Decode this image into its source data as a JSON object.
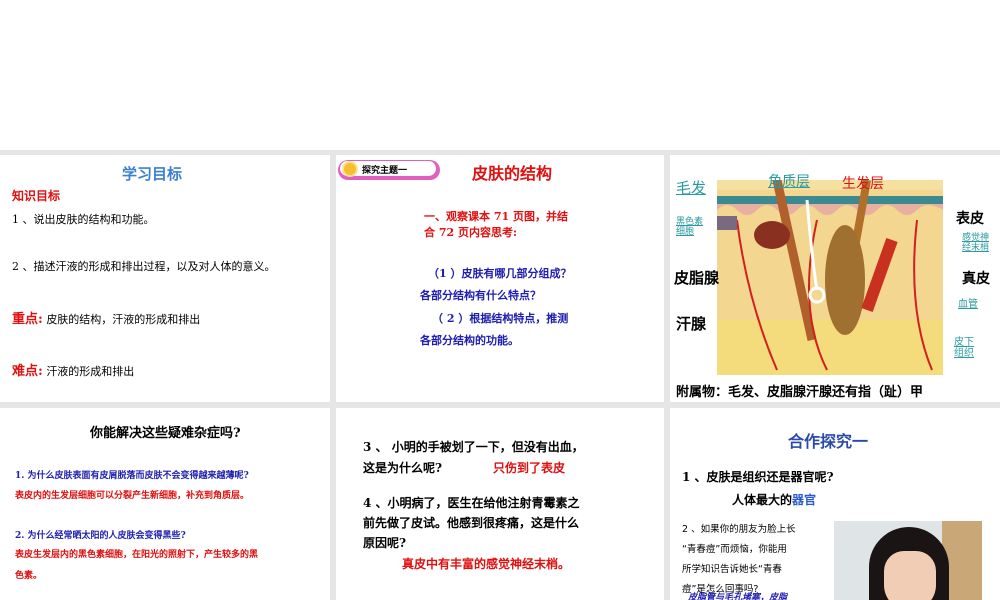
{
  "slide1": {
    "title": "学习目标",
    "subtitle": "知识目标",
    "item1": "1 、说出皮肤的结构和功能。",
    "item2": "2 、描述汗液的形成和排出过程，以及对人体的意义。",
    "key_label": "重点:",
    "key_text": "皮肤的结构，汗液的形成和排出",
    "diff_label": "难点:",
    "diff_text": "汗液的形成和排出"
  },
  "slide2": {
    "badge": "探究主题一",
    "title": "皮肤的结构",
    "intro1": "一、观察课本 71 页图，并结",
    "intro2": "合 72 页内容思考:",
    "q1a": "（1 ）皮肤有哪几部分组成？",
    "q1b": "各部分结构有什么特点？",
    "q2a": "（ 2 ）根据结构特点，推测",
    "q2b": "各部分结构的功能。"
  },
  "slide3": {
    "labels": {
      "hair": "毛发",
      "stratum": "角质层",
      "germ": "生发层",
      "melano": [
        "黑色素",
        "细胞"
      ],
      "sebaceous": "皮脂腺",
      "sweat": "汗腺",
      "epidermis": "表皮",
      "nerve": [
        "感觉神",
        "经末梢"
      ],
      "dermis": "真皮",
      "vessel": "血管",
      "subcut": [
        "皮下",
        "组织"
      ]
    },
    "caption": "附属物：毛发、皮脂腺汗腺还有指（趾）甲"
  },
  "slide4": {
    "title": "你能解决这些疑难杂症吗?",
    "q1": "1. 为什么皮肤表面有皮屑脱落而皮肤不会变得越来越薄呢?",
    "a1": "表皮内的生发层细胞可以分裂产生新细胞，补充到角质层。",
    "q2": "2. 为什么经常晒太阳的人皮肤会变得黑些?",
    "a2a": "表皮生发层内的黑色素细胞，在阳光的照射下，产生较多的黑",
    "a2b": "色素。"
  },
  "slide5": {
    "q3a": "3 、   小明的手被划了一下，但没有出血，",
    "q3b": "这是为什么呢?",
    "a3": "只伤到了表皮",
    "q4a": "4 、小明病了，医生在给他注射青霉素之",
    "q4b": "前先做了皮试。他感到很疼痛，这是什么",
    "q4c": "原因呢?",
    "a4": "真皮中有丰富的感觉神经末梢。"
  },
  "slide6": {
    "title": "合作探究一",
    "q1": "1 、皮肤是组织还是器官呢?",
    "a1_prefix": "人体最大的",
    "a1_highlight": "器官",
    "q2": [
      "2 、如果你的朋友为脸上长",
      "“青春痘”而烦恼，你能用",
      "所学知识告诉她长“青春",
      "痘”是怎么回事吗?"
    ],
    "a2": "皮脂管与毛孔堵塞，皮脂"
  }
}
